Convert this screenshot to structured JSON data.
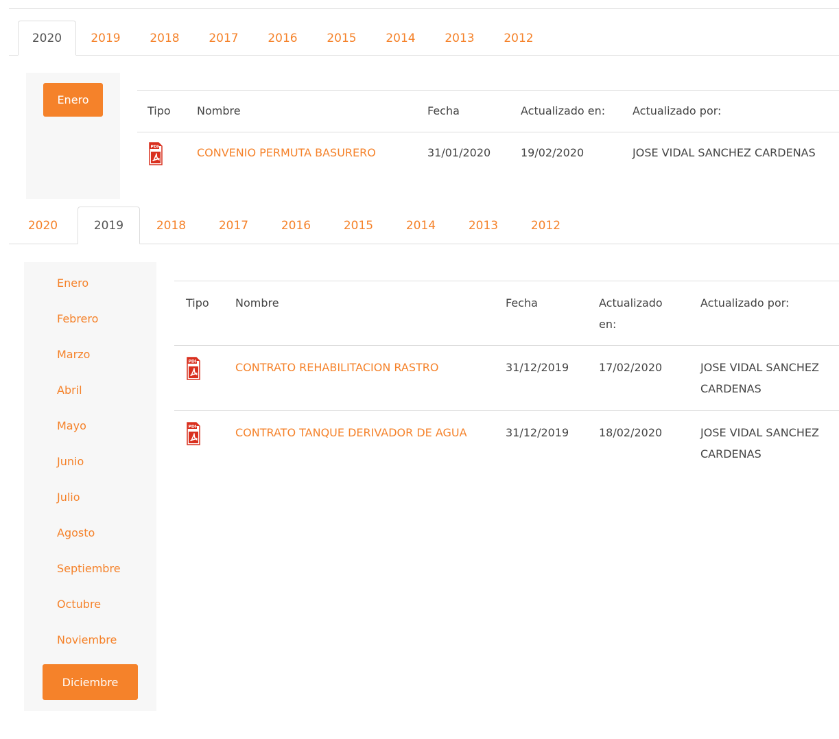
{
  "tabs_top": {
    "items": [
      {
        "label": "2020"
      },
      {
        "label": "2019"
      },
      {
        "label": "2018"
      },
      {
        "label": "2017"
      },
      {
        "label": "2016"
      },
      {
        "label": "2015"
      },
      {
        "label": "2014"
      },
      {
        "label": "2013"
      },
      {
        "label": "2012"
      }
    ],
    "active": "2020"
  },
  "months_top": {
    "items": [
      {
        "label": "Enero"
      }
    ],
    "active": "Enero"
  },
  "table_top": {
    "headers": {
      "tipo": "Tipo",
      "nombre": "Nombre",
      "fecha": "Fecha",
      "actualizado_en": "Actualizado en:",
      "actualizado_por": "Actualizado por:"
    },
    "rows": [
      {
        "tipo_icon": "pdf-icon",
        "nombre": "CONVENIO PERMUTA BASURERO",
        "fecha": "31/01/2020",
        "actualizado_en": "19/02/2020",
        "actualizado_por": "JOSE VIDAL SANCHEZ CARDENAS"
      }
    ]
  },
  "tabs_bottom": {
    "items": [
      {
        "label": "2020"
      },
      {
        "label": "2019"
      },
      {
        "label": "2018"
      },
      {
        "label": "2017"
      },
      {
        "label": "2016"
      },
      {
        "label": "2015"
      },
      {
        "label": "2014"
      },
      {
        "label": "2013"
      },
      {
        "label": "2012"
      }
    ],
    "active": "2019"
  },
  "months_bottom": {
    "items": [
      {
        "label": "Enero"
      },
      {
        "label": "Febrero"
      },
      {
        "label": "Marzo"
      },
      {
        "label": "Abril"
      },
      {
        "label": "Mayo"
      },
      {
        "label": "Junio"
      },
      {
        "label": "Julio"
      },
      {
        "label": "Agosto"
      },
      {
        "label": "Septiembre"
      },
      {
        "label": "Octubre"
      },
      {
        "label": "Noviembre"
      },
      {
        "label": "Diciembre"
      }
    ],
    "active": "Diciembre"
  },
  "table_bottom": {
    "headers": {
      "tipo": "Tipo",
      "nombre": "Nombre",
      "fecha": "Fecha",
      "actualizado_en": "Actualizado en:",
      "actualizado_por": "Actualizado por:"
    },
    "rows": [
      {
        "tipo_icon": "pdf-icon",
        "nombre": "CONTRATO REHABILITACION RASTRO",
        "fecha": "31/12/2019",
        "actualizado_en": "17/02/2020",
        "actualizado_por": "JOSE VIDAL SANCHEZ CARDENAS"
      },
      {
        "tipo_icon": "pdf-icon",
        "nombre": "CONTRATO TANQUE DERIVADOR DE AGUA",
        "fecha": "31/12/2019",
        "actualizado_en": "18/02/2020",
        "actualizado_por": "JOSE VIDAL SANCHEZ CARDENAS"
      }
    ]
  },
  "colors": {
    "accent": "#f5822a",
    "panel_bg": "#f7f7f7",
    "pdf_red": "#d9301f"
  }
}
